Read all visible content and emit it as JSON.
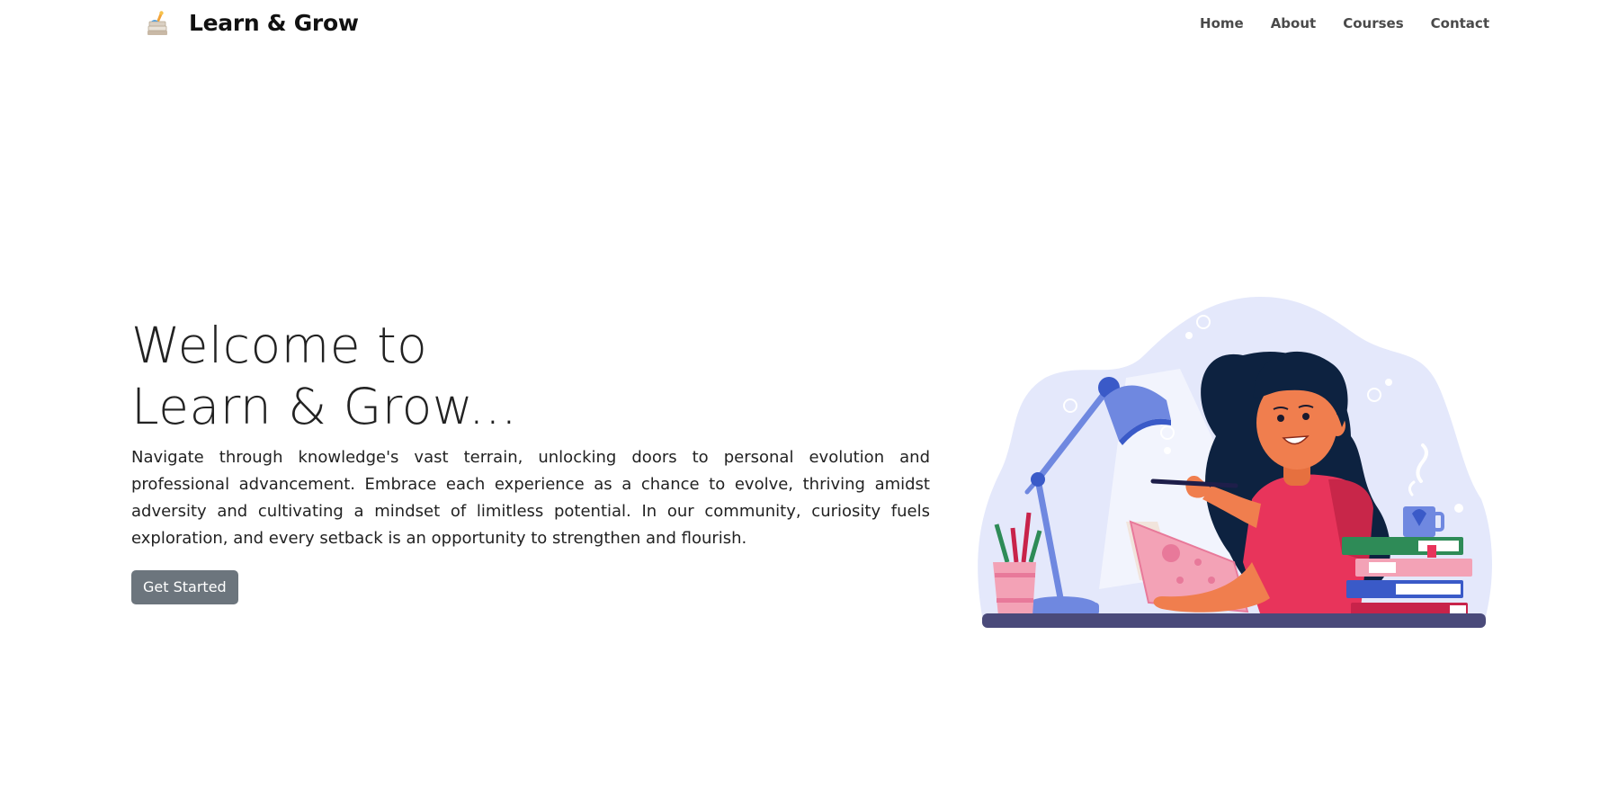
{
  "nav": {
    "brand_name": "Learn & Grow",
    "links": [
      {
        "label": "Home"
      },
      {
        "label": "About"
      },
      {
        "label": "Courses"
      },
      {
        "label": "Contact"
      }
    ]
  },
  "hero": {
    "title_line1": "Welcome to",
    "title_line2": "Learn & Grow...",
    "description": "Navigate through knowledge's vast terrain, unlocking doors to personal evolution and professional advancement. Embrace each experience as a chance to evolve, thriving amidst adversity and cultivating a mindset of limitless potential. In our community, curiosity fuels exploration, and every setback is an opportunity to strengthen and flourish.",
    "cta_label": "Get Started"
  },
  "colors": {
    "button_bg": "#6c757d",
    "text": "#212529",
    "blob": "#e4e8fb",
    "lamp": "#6f88e0",
    "shirt": "#e8345b",
    "hair": "#0d2240",
    "skin": "#f07e4e",
    "desk": "#4a4a7a"
  },
  "icons": {
    "brand_logo": "books-and-lamp-logo",
    "hero_illustration": "girl-studying-at-desk-illustration"
  }
}
